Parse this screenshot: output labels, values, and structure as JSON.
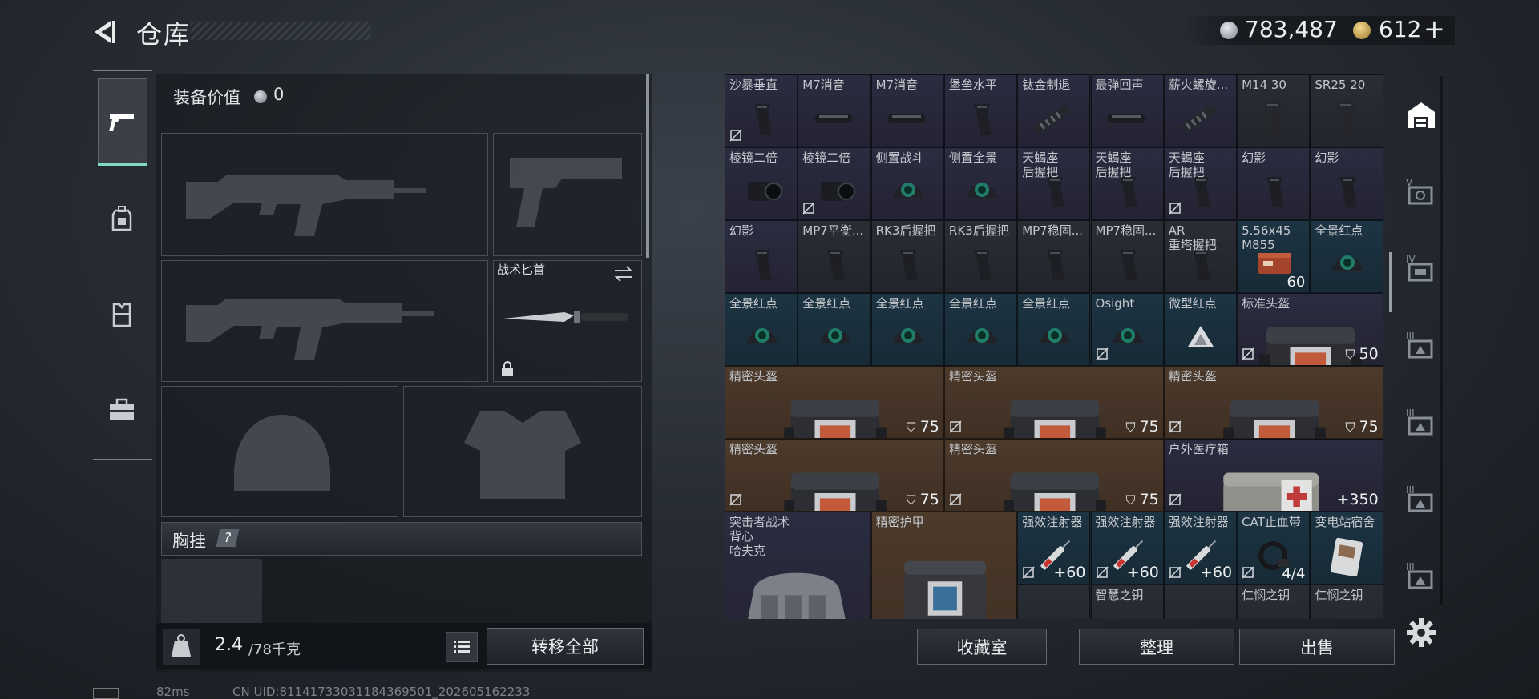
{
  "header": {
    "title": "仓库",
    "currency1": "783,487",
    "currency2": "612",
    "currency2_plus": "+"
  },
  "left_panel": {
    "value_label": "装备价值",
    "value": "0",
    "knife_label": "战术匕首",
    "chest_label": "胸挂",
    "chest_help": "?",
    "weight_current": "2.4",
    "weight_max": "/78千克",
    "transfer_all": "转移全部"
  },
  "grid": {
    "cells": [
      {
        "name": "沙暴垂直",
        "col": 0,
        "row": 0,
        "w": 1,
        "h": 1,
        "bg": "purple",
        "icon": "grip-icon",
        "nostar": true
      },
      {
        "name": "M7消音",
        "col": 1,
        "row": 0,
        "w": 1,
        "h": 1,
        "bg": "purple",
        "icon": "suppressor-icon"
      },
      {
        "name": "M7消音",
        "col": 2,
        "row": 0,
        "w": 1,
        "h": 1,
        "bg": "purple",
        "icon": "suppressor-icon"
      },
      {
        "name": "堡垒水平",
        "col": 3,
        "row": 0,
        "w": 1,
        "h": 1,
        "bg": "purple",
        "icon": "grip-icon"
      },
      {
        "name": "钛金制退",
        "col": 4,
        "row": 0,
        "w": 1,
        "h": 1,
        "bg": "purple",
        "icon": "muzzle-icon"
      },
      {
        "name": "最弹回声",
        "col": 5,
        "row": 0,
        "w": 1,
        "h": 1,
        "bg": "purple",
        "icon": "suppressor-icon"
      },
      {
        "name": "薪火螺旋...",
        "col": 6,
        "row": 0,
        "w": 1,
        "h": 1,
        "bg": "purple",
        "icon": "muzzle-icon"
      },
      {
        "name": "M14 30",
        "col": 7,
        "row": 0,
        "w": 1,
        "h": 1,
        "bg": "dark",
        "icon": "magazine-icon"
      },
      {
        "name": "SR25 20",
        "col": 8,
        "row": 0,
        "w": 1,
        "h": 1,
        "bg": "dark",
        "icon": "magazine-icon"
      },
      {
        "name": "棱镜二倍",
        "col": 0,
        "row": 1,
        "w": 1,
        "h": 1,
        "bg": "purple",
        "icon": "scope-icon"
      },
      {
        "name": "棱镜二倍",
        "col": 1,
        "row": 1,
        "w": 1,
        "h": 1,
        "bg": "purple",
        "icon": "scope-icon",
        "nostar": true
      },
      {
        "name": "侧置战斗",
        "col": 2,
        "row": 1,
        "w": 1,
        "h": 1,
        "bg": "purple",
        "icon": "sight-icon"
      },
      {
        "name": "侧置全景",
        "col": 3,
        "row": 1,
        "w": 1,
        "h": 1,
        "bg": "purple",
        "icon": "sight-icon"
      },
      {
        "name": "天蝎座\n后握把",
        "col": 4,
        "row": 1,
        "w": 1,
        "h": 1,
        "bg": "purple",
        "icon": "grip-icon"
      },
      {
        "name": "天蝎座\n后握把",
        "col": 5,
        "row": 1,
        "w": 1,
        "h": 1,
        "bg": "purple",
        "icon": "grip-icon"
      },
      {
        "name": "天蝎座\n后握把",
        "col": 6,
        "row": 1,
        "w": 1,
        "h": 1,
        "bg": "purple",
        "icon": "grip-icon",
        "nostar": true
      },
      {
        "name": "幻影",
        "col": 7,
        "row": 1,
        "w": 1,
        "h": 1,
        "bg": "purple",
        "icon": "grip-icon"
      },
      {
        "name": "幻影",
        "col": 8,
        "row": 1,
        "w": 1,
        "h": 1,
        "bg": "purple",
        "icon": "grip-icon"
      },
      {
        "name": "幻影",
        "col": 0,
        "row": 2,
        "w": 1,
        "h": 1,
        "bg": "purple",
        "icon": "grip-icon"
      },
      {
        "name": "MP7平衡...",
        "col": 1,
        "row": 2,
        "w": 1,
        "h": 1,
        "bg": "dark",
        "icon": "grip-icon"
      },
      {
        "name": "RK3后握把",
        "col": 2,
        "row": 2,
        "w": 1,
        "h": 1,
        "bg": "dark",
        "icon": "grip-icon"
      },
      {
        "name": "RK3后握把",
        "col": 3,
        "row": 2,
        "w": 1,
        "h": 1,
        "bg": "dark",
        "icon": "grip-icon"
      },
      {
        "name": "MP7稳固...",
        "col": 4,
        "row": 2,
        "w": 1,
        "h": 1,
        "bg": "dark",
        "icon": "grip-icon"
      },
      {
        "name": "MP7稳固...",
        "col": 5,
        "row": 2,
        "w": 1,
        "h": 1,
        "bg": "dark",
        "icon": "grip-icon"
      },
      {
        "name": "AR\n重塔握把",
        "col": 6,
        "row": 2,
        "w": 1,
        "h": 1,
        "bg": "dark",
        "icon": "grip-icon"
      },
      {
        "name": "5.56x45\nM855",
        "col": 7,
        "row": 2,
        "w": 1,
        "h": 1,
        "bg": "blue",
        "icon": "ammo-icon",
        "count": "60"
      },
      {
        "name": "全景红点",
        "col": 8,
        "row": 2,
        "w": 1,
        "h": 1,
        "bg": "blue",
        "icon": "sight-icon"
      },
      {
        "name": "全景红点",
        "col": 0,
        "row": 3,
        "w": 1,
        "h": 1,
        "bg": "blue",
        "icon": "sight-icon"
      },
      {
        "name": "全景红点",
        "col": 1,
        "row": 3,
        "w": 1,
        "h": 1,
        "bg": "blue",
        "icon": "sight-icon"
      },
      {
        "name": "全景红点",
        "col": 2,
        "row": 3,
        "w": 1,
        "h": 1,
        "bg": "blue",
        "icon": "sight-icon"
      },
      {
        "name": "全景红点",
        "col": 3,
        "row": 3,
        "w": 1,
        "h": 1,
        "bg": "blue",
        "icon": "sight-icon"
      },
      {
        "name": "全景红点",
        "col": 4,
        "row": 3,
        "w": 1,
        "h": 1,
        "bg": "blue",
        "icon": "sight-icon"
      },
      {
        "name": "Osight",
        "col": 5,
        "row": 3,
        "w": 1,
        "h": 1,
        "bg": "blue",
        "icon": "sight-icon",
        "nostar": true
      },
      {
        "name": "微型红点",
        "col": 6,
        "row": 3,
        "w": 1,
        "h": 1,
        "bg": "blue",
        "icon": "triangle-icon"
      },
      {
        "name": "标准头盔",
        "col": 7,
        "row": 3,
        "w": 2,
        "h": 1,
        "bg": "purple",
        "icon": "helmet-icon",
        "armor": "50",
        "nostar": true
      },
      {
        "name": "精密头盔",
        "col": 0,
        "row": 4,
        "w": 3,
        "h": 1,
        "bg": "brown",
        "icon": "helmet-icon",
        "armor": "75"
      },
      {
        "name": "精密头盔",
        "col": 3,
        "row": 4,
        "w": 3,
        "h": 1,
        "bg": "brown",
        "icon": "helmet-icon",
        "armor": "75",
        "nostar": true
      },
      {
        "name": "精密头盔",
        "col": 6,
        "row": 4,
        "w": 3,
        "h": 1,
        "bg": "brown",
        "icon": "helmet-icon",
        "armor": "75",
        "nostar": true
      },
      {
        "name": "精密头盔",
        "col": 0,
        "row": 5,
        "w": 3,
        "h": 1,
        "bg": "brown",
        "icon": "helmet-icon",
        "armor": "75",
        "nostar": true
      },
      {
        "name": "精密头盔",
        "col": 3,
        "row": 5,
        "w": 3,
        "h": 1,
        "bg": "brown",
        "icon": "helmet-icon",
        "armor": "75",
        "nostar": true
      },
      {
        "name": "户外医疗箱",
        "col": 6,
        "row": 5,
        "w": 3,
        "h": 1,
        "bg": "purple",
        "icon": "medkit-icon",
        "heal": "350",
        "nostar": true
      },
      {
        "name": "突击者战术背心\n哈夫克",
        "col": 0,
        "row": 6,
        "w": 2,
        "h": 2,
        "bg": "purple",
        "icon": "vest-icon"
      },
      {
        "name": "精密护甲",
        "col": 2,
        "row": 6,
        "w": 2,
        "h": 2,
        "bg": "brown",
        "icon": "armor-icon"
      },
      {
        "name": "强效注射器",
        "col": 4,
        "row": 6,
        "w": 1,
        "h": 1,
        "bg": "blue",
        "icon": "syringe-icon",
        "heal": "60",
        "nostar": true
      },
      {
        "name": "强效注射器",
        "col": 5,
        "row": 6,
        "w": 1,
        "h": 1,
        "bg": "blue",
        "icon": "syringe-icon",
        "heal": "60",
        "nostar": true
      },
      {
        "name": "强效注射器",
        "col": 6,
        "row": 6,
        "w": 1,
        "h": 1,
        "bg": "blue",
        "icon": "syringe-icon",
        "heal": "60",
        "nostar": true
      },
      {
        "name": "CAT止血带",
        "col": 7,
        "row": 6,
        "w": 1,
        "h": 1,
        "bg": "blue",
        "icon": "tourniquet-icon",
        "count": "4/4",
        "nostar": true
      },
      {
        "name": "变电站宿舍",
        "col": 8,
        "row": 6,
        "w": 1,
        "h": 1,
        "bg": "blue",
        "icon": "card-icon"
      },
      {
        "name": "",
        "col": 4,
        "row": 7,
        "w": 1,
        "h": 1,
        "bg": "dark",
        "icon": "key-icon"
      },
      {
        "name": "智慧之钥",
        "col": 5,
        "row": 7,
        "w": 1,
        "h": 1,
        "bg": "dark",
        "icon": "key-icon"
      },
      {
        "name": "",
        "col": 6,
        "row": 7,
        "w": 1,
        "h": 1,
        "bg": "dark",
        "icon": "key-icon"
      },
      {
        "name": "仁悯之钥",
        "col": 7,
        "row": 7,
        "w": 1,
        "h": 1,
        "bg": "dark",
        "icon": "key-icon"
      },
      {
        "name": "仁悯之钥",
        "col": 8,
        "row": 7,
        "w": 1,
        "h": 1,
        "bg": "dark",
        "icon": "key-icon"
      }
    ]
  },
  "buttons": {
    "collection": "收藏室",
    "organize": "整理",
    "sell": "出售"
  },
  "status": {
    "ping": "82ms",
    "uid": "CN UID:81141733031184369501_202605162233"
  },
  "colors": {
    "accent": "#7ed9c9",
    "purple": "#2c2c41",
    "blue": "#1d3443",
    "brown": "#4c3a2b"
  }
}
